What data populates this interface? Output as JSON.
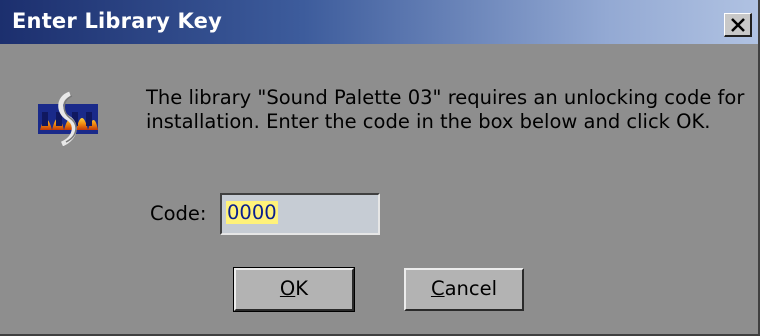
{
  "window": {
    "title": "Enter Library Key",
    "close_icon": "close-icon"
  },
  "message": {
    "line1": "The library \"Sound Palette 03\" requires an unlocking code for",
    "line2": "installation.  Enter the code in the box below and click OK."
  },
  "code_field": {
    "label": "Code:",
    "value": "0000"
  },
  "buttons": {
    "ok_mnemonic": "O",
    "ok_rest": "K",
    "cancel_mnemonic": "C",
    "cancel_rest": "ancel"
  },
  "icons": {
    "app": "app-logo-icon"
  },
  "colors": {
    "titlebar_start": "#1c2f6e",
    "titlebar_end": "#b0c2e2",
    "dialog_bg": "#8e8e8e",
    "selection_bg": "#fff27a",
    "selection_text": "#0a1f8f"
  }
}
